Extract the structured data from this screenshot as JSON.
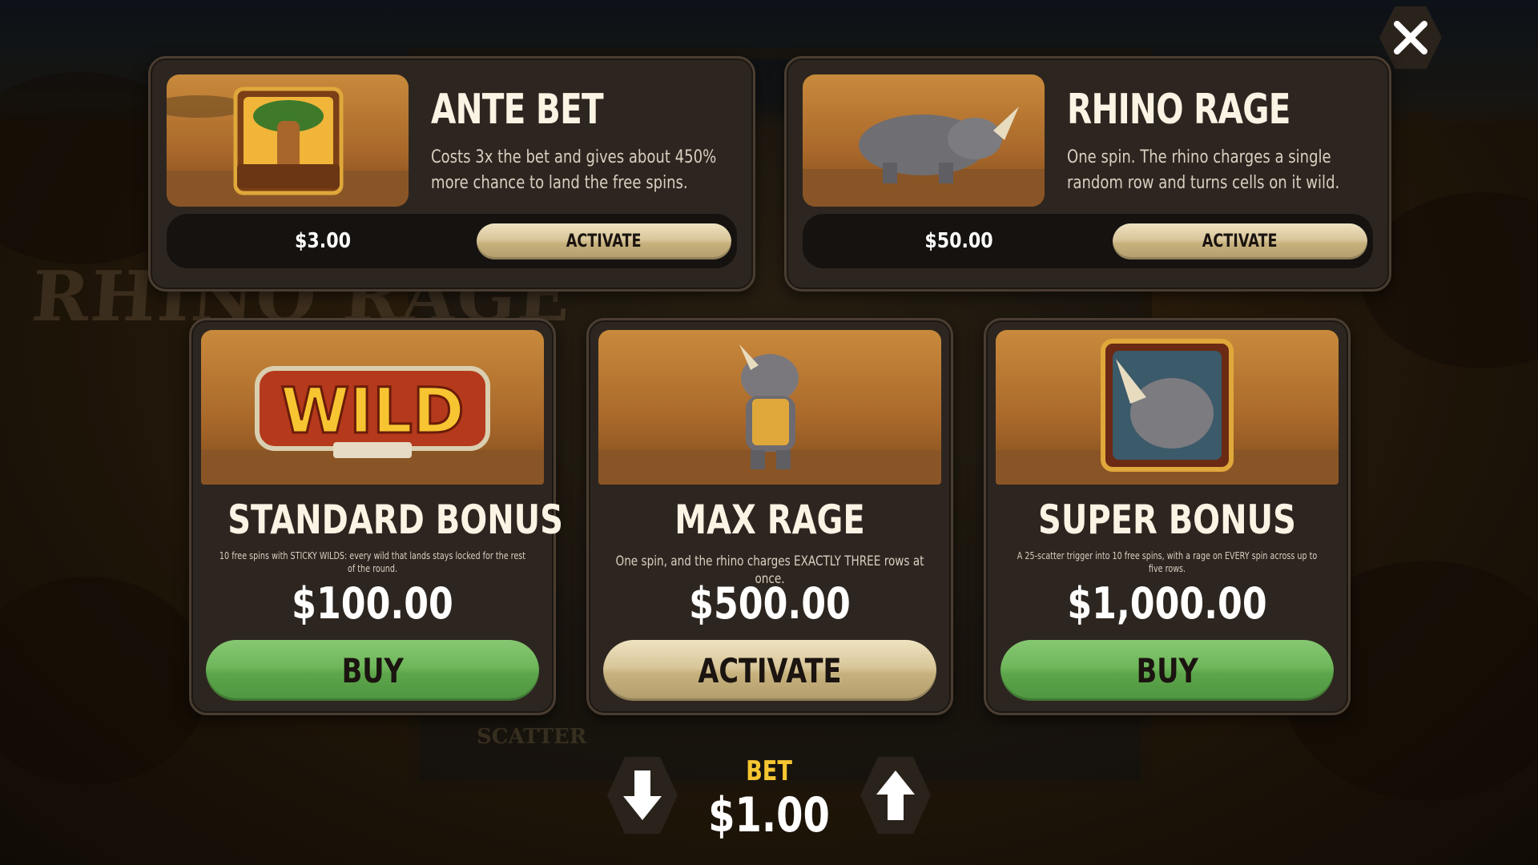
{
  "background": {
    "logo_text": "RHINO RAGE",
    "reel_text": "SCATTER"
  },
  "top_cards": [
    {
      "title": "ANTE BET",
      "description": "Costs 3x the bet and gives about 450% more chance to land the free spins.",
      "price": "$3.00",
      "button_label": "ACTIVATE",
      "image_label": "SCATTER"
    },
    {
      "title": "RHINO RAGE",
      "description": "One spin. The rhino charges a single random row and turns cells on it wild.",
      "price": "$50.00",
      "button_label": "ACTIVATE"
    }
  ],
  "bottom_cards": [
    {
      "title": "STANDARD BONUS",
      "description": "10 free spins with STICKY WILDS: every wild that lands stays locked for the rest of the round.",
      "price": "$100.00",
      "button_label": "BUY",
      "image_label": "WILD"
    },
    {
      "title": "MAX RAGE",
      "description": "One spin, and the rhino charges EXACTLY THREE rows at once.",
      "price": "$500.00",
      "button_label": "ACTIVATE"
    },
    {
      "title": "SUPER BONUS",
      "description": "A 25-scatter trigger into 10 free spins, with a rage on EVERY spin across up to five rows.",
      "price": "$1,000.00",
      "button_label": "BUY"
    }
  ],
  "bet": {
    "label": "BET",
    "value": "$1.00"
  },
  "colors": {
    "panel": "#2d2620",
    "tan_button": "#d9c69a",
    "green_button": "#6fb65b",
    "bet_label": "#f5c632"
  },
  "icons": {
    "close": "close-icon",
    "decrease": "arrow-down-icon",
    "increase": "arrow-up-icon"
  }
}
